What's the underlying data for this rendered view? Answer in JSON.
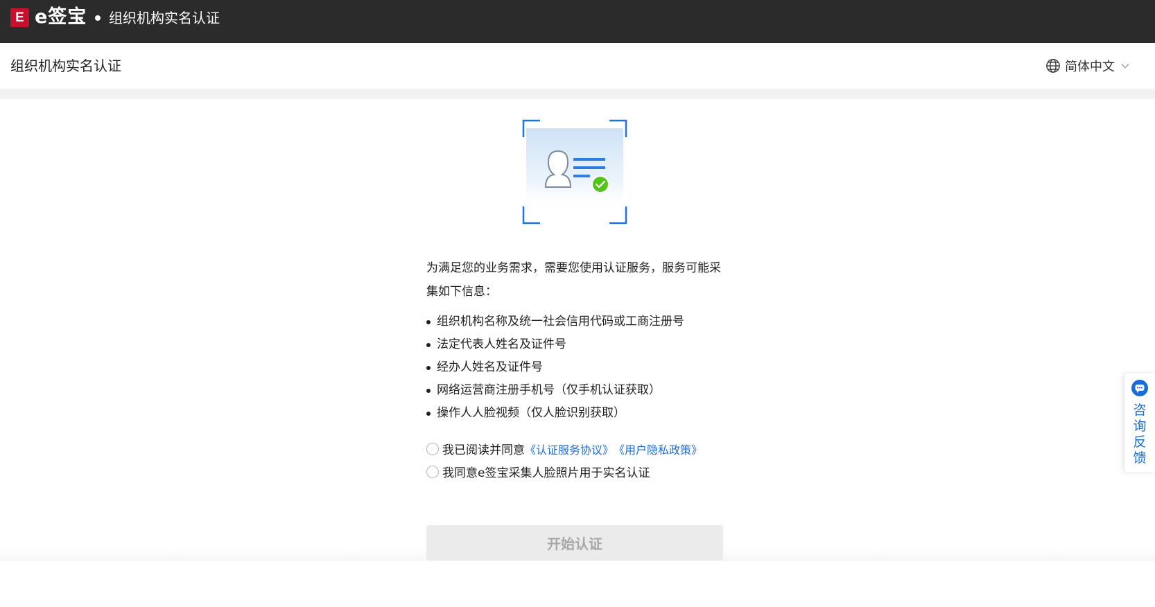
{
  "app": {
    "logo_letter": "E",
    "brand": "e签宝",
    "title": "组织机构实名认证"
  },
  "header": {
    "page_title": "组织机构实名认证",
    "language": "简体中文"
  },
  "main": {
    "intro": "为满足您的业务需求，需要您使用认证服务，服务可能采集如下信息：",
    "info_items": [
      "组织机构名称及统一社会信用代码或工商注册号",
      "法定代表人姓名及证件号",
      "经办人姓名及证件号",
      "网络运营商注册手机号（仅手机认证获取）",
      "操作人人脸视频（仅人脸识别获取）"
    ],
    "agreement": {
      "prefix": "我已阅读并同意",
      "link_service": "《认证服务协议》",
      "link_privacy": "《用户隐私政策》",
      "checked": false
    },
    "face_consent": {
      "label": "我同意e签宝采集人脸照片用于实名认证",
      "checked": false
    },
    "start_button": "开始认证"
  },
  "feedback": {
    "label": "咨询反馈",
    "icon": "chat-bubble-icon"
  },
  "colors": {
    "topbar": "#2b2b2b",
    "brand_red": "#c8102e",
    "link_blue": "#1a6dd6",
    "success_green": "#52c41a",
    "button_disabled_bg": "#ebebeb",
    "button_disabled_text": "#a7a7a7"
  }
}
